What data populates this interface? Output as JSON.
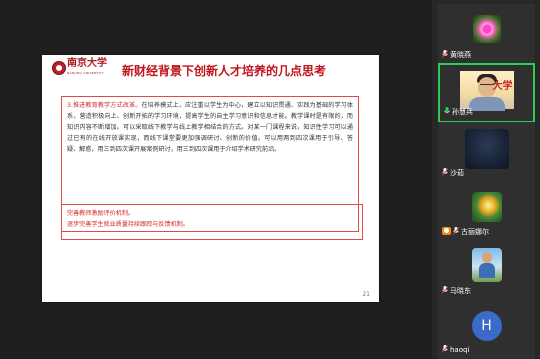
{
  "slide": {
    "logo_text": "南京大学",
    "logo_sub": "NANJING UNIVERSITY",
    "title": "新财经背景下创新人才培养的几点思考",
    "box1_lead": "3.推进教育教学方式改革。",
    "box1_body": "在培养模式上，应注重以学生为中心，建立以知识贯通、实践为基础的学习体系，营造积极向上、创新开拓的学习环境，提高学生的自主学习意识和信息才能。教学课时是有限的，而知识内容不断增加。可以采取线下教学与线上教学相结合的方式。对某一门课程来说，知识性学习可以通过已有的在线开放课实现，而线下课堂要更加强调研讨、创新的价值。可以用两到四次课用于引导、答疑、解惑，用三到四次课开展案例研讨，用三到四次课用于介绍学术研究前沿。",
    "box2_line1": "完善教师激励评价机制。",
    "box2_line2": "逐步完善学生就业质量持续跟踪与反馈机制。",
    "page_number": "21"
  },
  "participants": [
    {
      "name": "黄晓燕",
      "muted": true
    },
    {
      "name": "孙慧兵",
      "muted": false,
      "speaking": true
    },
    {
      "name": "沙茹",
      "muted": true
    },
    {
      "name": "古丽娜尔",
      "muted": true,
      "host_badge": true
    },
    {
      "name": "马晓东",
      "muted": true
    },
    {
      "name": "haoqi",
      "muted": true,
      "initial": "H"
    }
  ],
  "colors": {
    "accent_red": "#c0141c",
    "active_speaker": "#2ecc55",
    "avatar_blue": "#3a6bc9"
  }
}
